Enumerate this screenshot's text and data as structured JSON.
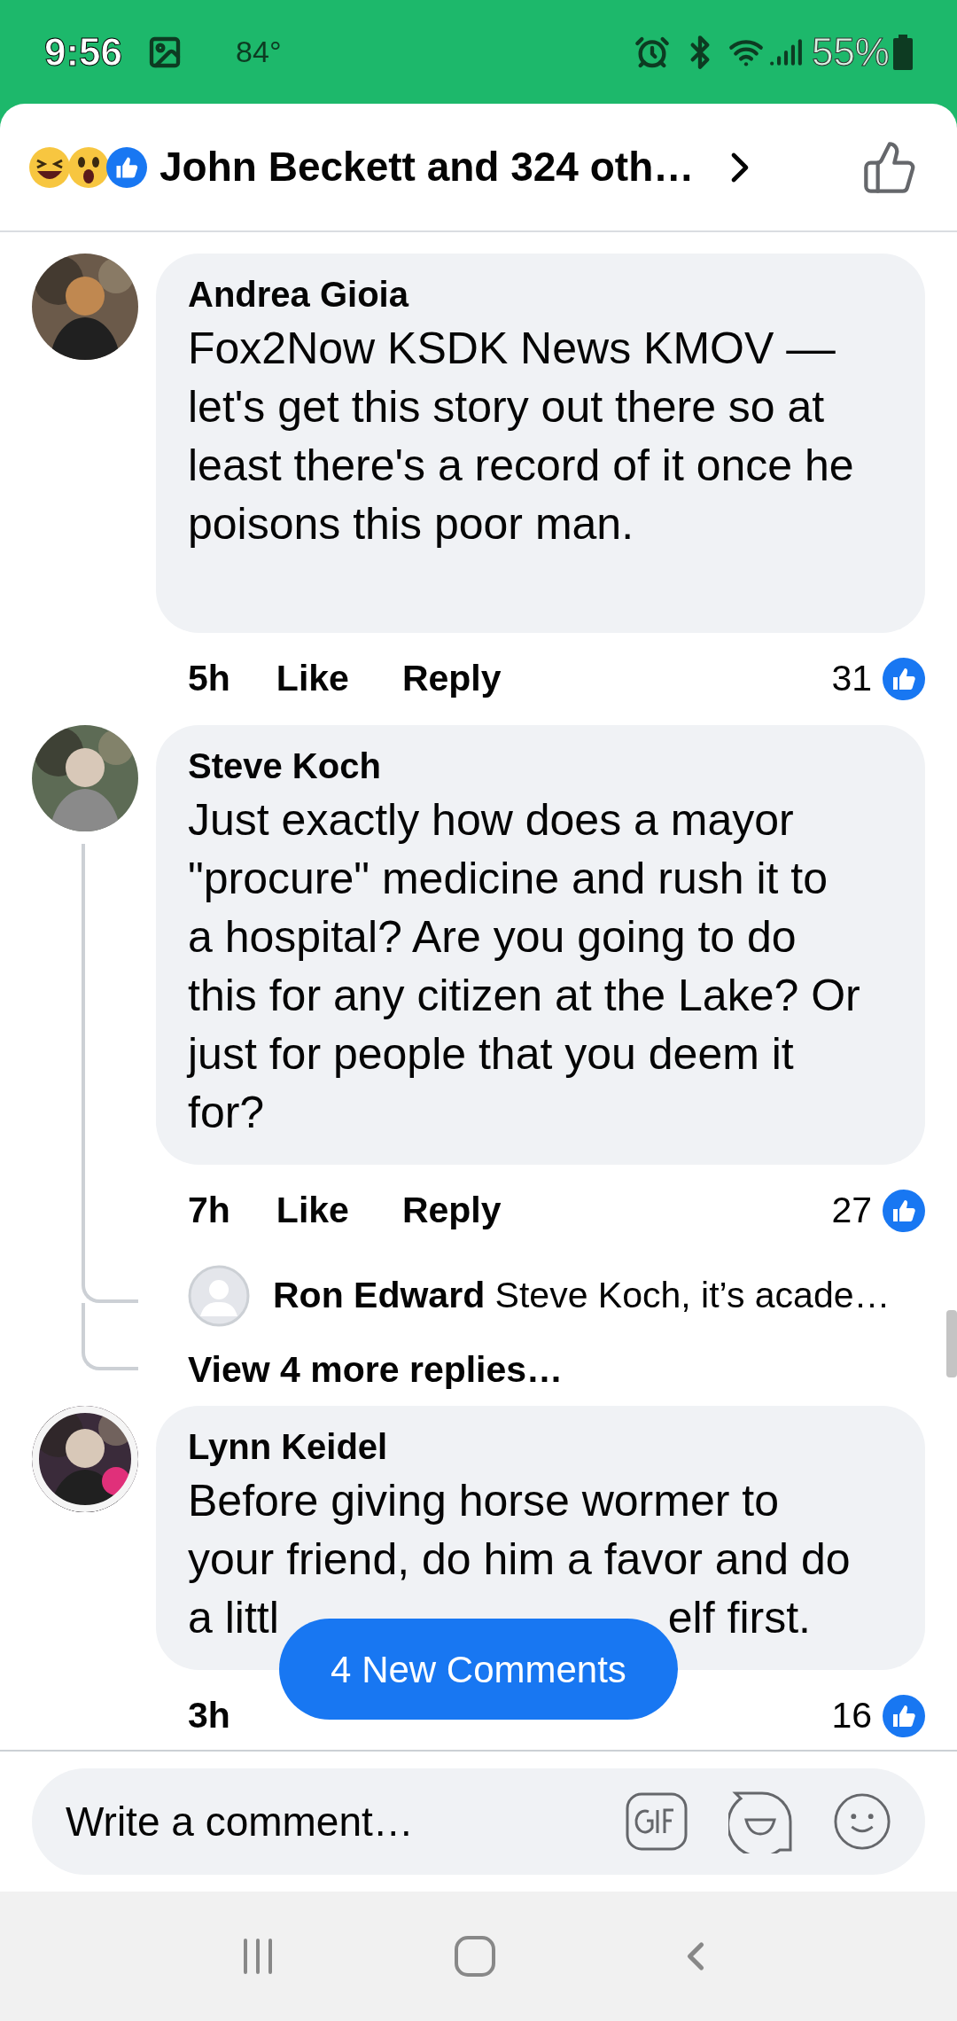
{
  "status_bar": {
    "time": "9:56",
    "temperature": "84°",
    "battery": "55%"
  },
  "header": {
    "reactions_text": "John Beckett and 324 oth…"
  },
  "comments": [
    {
      "author": "Andrea Gioia",
      "body": "Fox2Now KSDK News KMOV –– let's get this story out there so at least there's a record of it once he poisons this poor man.",
      "time": "5h",
      "like": "Like",
      "reply": "Reply",
      "reaction_count": "31"
    },
    {
      "author": "Steve Koch",
      "body": "Just exactly how does a mayor \"procure\" medicine and rush it to a hospital? Are you going to do this for any citizen at the Lake? Or just for people that you deem it for?",
      "time": "7h",
      "like": "Like",
      "reply": "Reply",
      "reaction_count": "27",
      "replies": [
        {
          "author": "Ron Edward",
          "preview": "Steve Koch, it’s acade…"
        }
      ],
      "more_replies": "View 4 more replies…"
    },
    {
      "author": "Lynn Keidel",
      "body": "Before giving horse wormer to your friend, do him a favor and do a littl",
      "body_end": "elf first.",
      "time": "3h",
      "reaction_count": "16"
    }
  ],
  "new_comments_button": "4 New Comments",
  "composer": {
    "placeholder": "Write a comment…"
  }
}
